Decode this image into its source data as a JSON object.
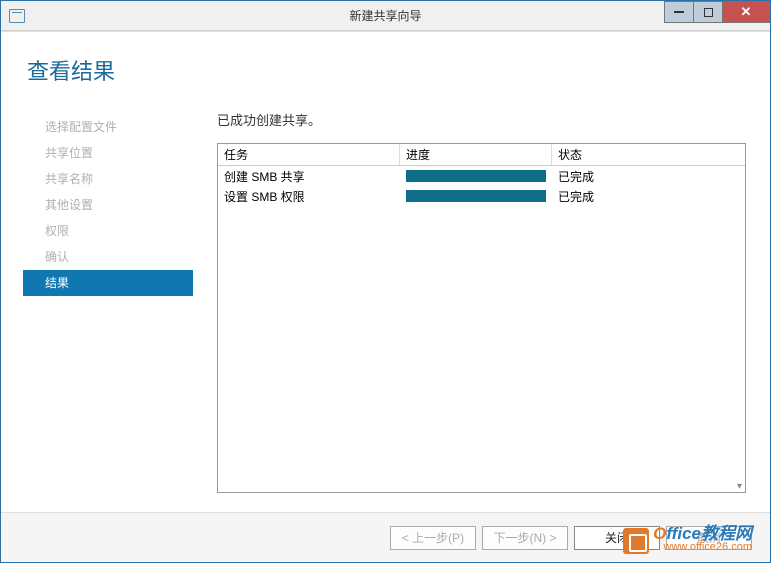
{
  "window": {
    "title": "新建共享向导"
  },
  "page": {
    "title": "查看结果",
    "summary": "已成功创建共享。"
  },
  "sidebar": {
    "items": [
      {
        "label": "选择配置文件",
        "active": false
      },
      {
        "label": "共享位置",
        "active": false
      },
      {
        "label": "共享名称",
        "active": false
      },
      {
        "label": "其他设置",
        "active": false
      },
      {
        "label": "权限",
        "active": false
      },
      {
        "label": "确认",
        "active": false
      },
      {
        "label": "结果",
        "active": true
      }
    ]
  },
  "table": {
    "headers": {
      "task": "任务",
      "progress": "进度",
      "status": "状态"
    },
    "rows": [
      {
        "task": "创建 SMB 共享",
        "progress": 100,
        "status": "已完成"
      },
      {
        "task": "设置 SMB 权限",
        "progress": 100,
        "status": "已完成"
      }
    ]
  },
  "footer": {
    "previous": "< 上一步(P)",
    "next": "下一步(N) >",
    "close": "关闭",
    "cancel": "取消"
  },
  "watermark": {
    "line1_first": "O",
    "line1_rest": "ffice教程网",
    "line2": "www.office26.com"
  }
}
